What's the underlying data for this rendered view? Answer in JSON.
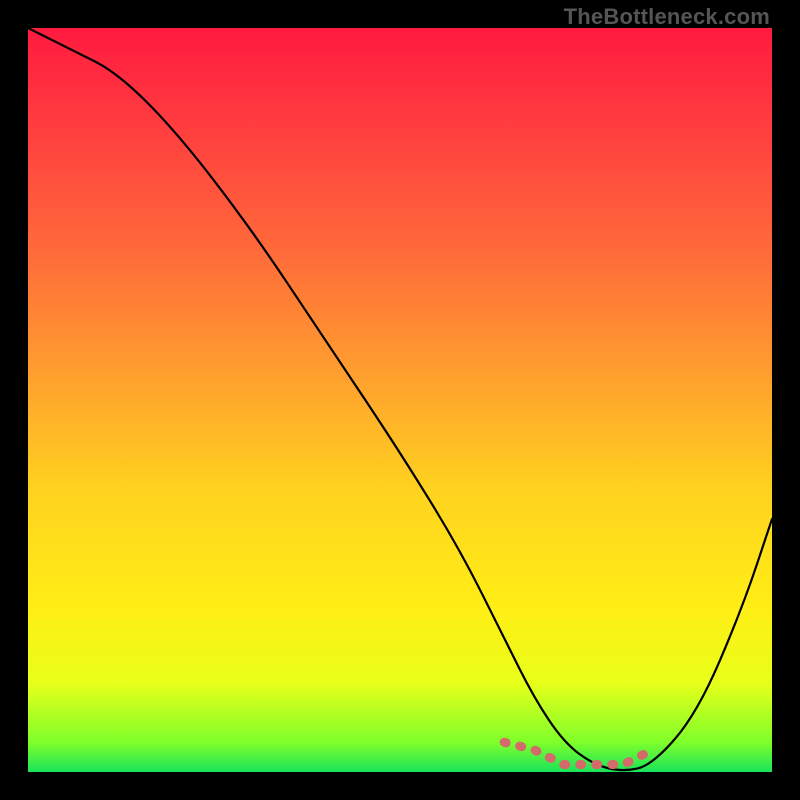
{
  "attribution": "TheBottleneck.com",
  "chart_data": {
    "type": "line",
    "title": "",
    "xlabel": "",
    "ylabel": "",
    "xlim": [
      0,
      100
    ],
    "ylim": [
      0,
      100
    ],
    "series": [
      {
        "name": "bottleneck-curve",
        "x": [
          0,
          6,
          12,
          20,
          30,
          40,
          50,
          58,
          64,
          68,
          72,
          76,
          80,
          84,
          90,
          96,
          100
        ],
        "values": [
          100,
          97,
          94,
          86,
          73,
          58,
          43,
          30,
          18,
          10,
          4,
          1,
          0,
          1,
          8,
          22,
          34
        ]
      }
    ],
    "marker_segment": {
      "name": "optimal-range",
      "color": "#d46a6a",
      "x": [
        64,
        68,
        72,
        76,
        80,
        84
      ],
      "values": [
        4,
        3,
        1,
        1,
        1,
        3
      ]
    },
    "colors": {
      "background_top": "#ff1a3f",
      "background_bottom": "#19e35a",
      "curve": "#000000",
      "marker": "#d46a6a",
      "frame": "#000000"
    }
  }
}
